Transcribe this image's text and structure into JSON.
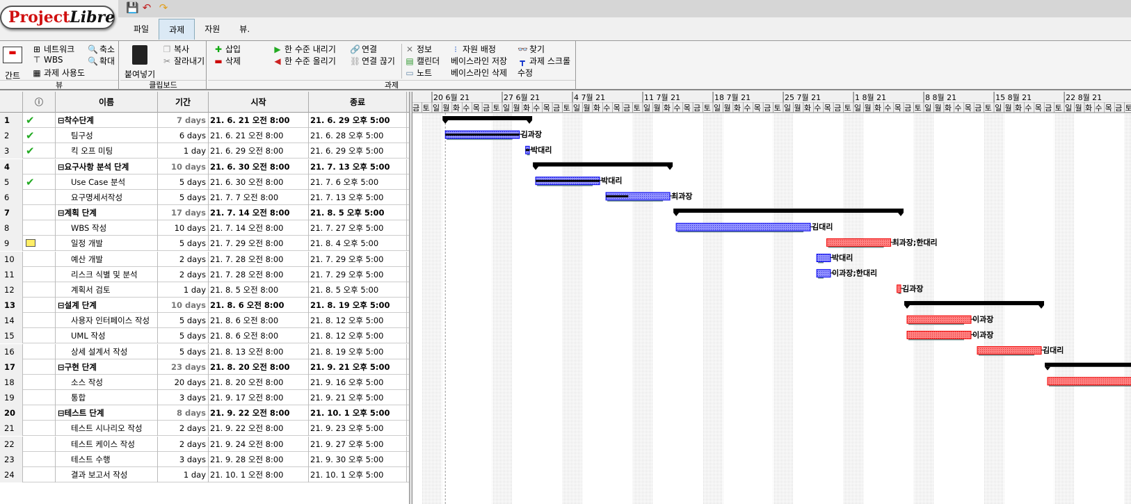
{
  "app": {
    "logo_text": "ProjectLibre",
    "logo_red": "Project",
    "logo_black": "Libre"
  },
  "quick_access": [
    {
      "icon": "save-icon"
    },
    {
      "icon": "undo-icon"
    },
    {
      "icon": "redo-icon"
    }
  ],
  "tabs": [
    {
      "label": "파일"
    },
    {
      "label": "과제",
      "active": true
    },
    {
      "label": "자원"
    },
    {
      "label": "뷰."
    }
  ],
  "ribbon": {
    "view": {
      "label": "뷰",
      "gantt": "간트",
      "network": "네트워크",
      "wbs": "WBS",
      "task_usage": "과제 사용도",
      "zoom_out": "축소",
      "zoom_in": "확대"
    },
    "clipboard": {
      "label": "클립보드",
      "paste": "붙여넣기",
      "copy": "복사",
      "cut": "잘라내기"
    },
    "task": {
      "label": "과제",
      "insert": "삽입",
      "delete": "삭제",
      "indent": "한 수준 내리기",
      "outdent": "한 수준 올리기",
      "link": "연결",
      "unlink": "연결 끊기",
      "info": "정보",
      "calendar": "캘린더",
      "notes": "노트",
      "assign": "자원 배정",
      "save_baseline": "베이스라인 저장",
      "clear_baseline": "베이스라인 삭제",
      "find": "찾기",
      "scroll_to_task": "과제 스크롤",
      "edit": "수정"
    }
  },
  "table": {
    "headers": {
      "info": "ⓘ",
      "name": "이름",
      "duration": "기간",
      "start": "시작",
      "finish": "종료"
    },
    "rows": [
      {
        "id": "1",
        "ind": "check",
        "name": "⊟착수단계",
        "dur": "7 days",
        "start": "21. 6. 21 오전 8:00",
        "end": "21. 6. 29 오후 5:00",
        "summary": true,
        "gs": "2021-06-21T08",
        "ge": "2021-06-29T17"
      },
      {
        "id": "2",
        "ind": "check",
        "name": "팀구성",
        "dur": "6 days",
        "start": "21. 6. 21 오전 8:00",
        "end": "21. 6. 28 오후 5:00",
        "gs": "2021-06-21T08",
        "ge": "2021-06-28T17",
        "res": "김과장",
        "progress": 100
      },
      {
        "id": "3",
        "ind": "check",
        "name": "킥 오프 미팅",
        "dur": "1 day",
        "start": "21. 6. 29 오전 8:00",
        "end": "21. 6. 29 오후 5:00",
        "gs": "2021-06-29T08",
        "ge": "2021-06-29T17",
        "res": "박대리",
        "progress": 100
      },
      {
        "id": "4",
        "name": "⊟요구사항 분석 단계",
        "dur": "10 days",
        "start": "21. 6. 30 오전 8:00",
        "end": "21. 7. 13 오후 5:00",
        "summary": true,
        "gs": "2021-06-30T08",
        "ge": "2021-07-13T17"
      },
      {
        "id": "5",
        "ind": "check",
        "name": "Use Case 분석",
        "dur": "5 days",
        "start": "21. 6. 30 오전 8:00",
        "end": "21. 7. 6 오후 5:00",
        "gs": "2021-06-30T08",
        "ge": "2021-07-06T17",
        "res": "박대리",
        "progress": 100
      },
      {
        "id": "6",
        "name": "요구명세서작성",
        "dur": "5 days",
        "start": "21. 7. 7 오전 8:00",
        "end": "21. 7. 13 오후 5:00",
        "gs": "2021-07-07T08",
        "ge": "2021-07-13T17",
        "res": "최과장",
        "progress": 35
      },
      {
        "id": "7",
        "name": "⊟계획 단계",
        "dur": "17 days",
        "start": "21. 7. 14 오전 8:00",
        "end": "21. 8. 5 오후 5:00",
        "summary": true,
        "gs": "2021-07-14T08",
        "ge": "2021-08-05T17"
      },
      {
        "id": "8",
        "name": "WBS 작성",
        "dur": "10 days",
        "start": "21. 7. 14 오전 8:00",
        "end": "21. 7. 27 오후 5:00",
        "gs": "2021-07-14T08",
        "ge": "2021-07-27T17",
        "res": "김대리"
      },
      {
        "id": "9",
        "ind": "calendar",
        "name": "일정 개발",
        "dur": "5 days",
        "start": "21. 7. 29 오전 8:00",
        "end": "21. 8. 4 오후 5:00",
        "gs": "2021-07-29T08",
        "ge": "2021-08-04T17",
        "res": "최과장;한대리",
        "critical": true
      },
      {
        "id": "10",
        "name": "예산 개발",
        "dur": "2 days",
        "start": "21. 7. 28 오전 8:00",
        "end": "21. 7. 29 오후 5:00",
        "gs": "2021-07-28T08",
        "ge": "2021-07-29T17",
        "res": "박대리"
      },
      {
        "id": "11",
        "name": "리스크 식별 및 분석",
        "dur": "2 days",
        "start": "21. 7. 28 오전 8:00",
        "end": "21. 7. 29 오후 5:00",
        "gs": "2021-07-28T08",
        "ge": "2021-07-29T17",
        "res": "이과장;한대리"
      },
      {
        "id": "12",
        "name": "계획서 검토",
        "dur": "1 day",
        "start": "21. 8. 5 오전 8:00",
        "end": "21. 8. 5 오후 5:00",
        "gs": "2021-08-05T08",
        "ge": "2021-08-05T17",
        "res": "김과장",
        "critical": true
      },
      {
        "id": "13",
        "name": "⊟설계 단계",
        "dur": "10 days",
        "start": "21. 8. 6 오전 8:00",
        "end": "21. 8. 19 오후 5:00",
        "summary": true,
        "gs": "2021-08-06T08",
        "ge": "2021-08-19T17"
      },
      {
        "id": "14",
        "name": "사용자 인터페이스 작성",
        "dur": "5 days",
        "start": "21. 8. 6 오전 8:00",
        "end": "21. 8. 12 오후 5:00",
        "gs": "2021-08-06T08",
        "ge": "2021-08-12T17",
        "res": "이과장",
        "critical": true
      },
      {
        "id": "15",
        "name": "UML 작성",
        "dur": "5 days",
        "start": "21. 8. 6 오전 8:00",
        "end": "21. 8. 12 오후 5:00",
        "gs": "2021-08-06T08",
        "ge": "2021-08-12T17",
        "res": "이과장",
        "critical": true
      },
      {
        "id": "16",
        "name": "상세 설계서 작성",
        "dur": "5 days",
        "start": "21. 8. 13 오전 8:00",
        "end": "21. 8. 19 오후 5:00",
        "gs": "2021-08-13T08",
        "ge": "2021-08-19T17",
        "res": "김대리",
        "critical": true
      },
      {
        "id": "17",
        "name": "⊟구현 단계",
        "dur": "23 days",
        "start": "21. 8. 20 오전 8:00",
        "end": "21. 9. 21 오후 5:00",
        "summary": true,
        "gs": "2021-08-20T08",
        "ge": "2021-09-21T17"
      },
      {
        "id": "18",
        "name": "소스 작성",
        "dur": "20 days",
        "start": "21. 8. 20 오전 8:00",
        "end": "21. 9. 16 오후 5:00",
        "gs": "2021-08-20T08",
        "ge": "2021-09-16T17",
        "critical": true
      },
      {
        "id": "19",
        "name": "통합",
        "dur": "3 days",
        "start": "21. 9. 17 오전 8:00",
        "end": "21. 9. 21 오후 5:00"
      },
      {
        "id": "20",
        "name": "⊟테스트 단계",
        "dur": "8 days",
        "start": "21. 9. 22 오전 8:00",
        "end": "21. 10. 1 오후 5:00",
        "summary": true
      },
      {
        "id": "21",
        "name": "테스트 시나리오 작성",
        "dur": "2 days",
        "start": "21. 9. 22 오전 8:00",
        "end": "21. 9. 23 오후 5:00"
      },
      {
        "id": "22",
        "name": "테스트 케이스 작성",
        "dur": "2 days",
        "start": "21. 9. 24 오전 8:00",
        "end": "21. 9. 27 오후 5:00"
      },
      {
        "id": "23",
        "name": "테스트 수행",
        "dur": "3 days",
        "start": "21. 9. 28 오전 8:00",
        "end": "21. 9. 30 오후 5:00"
      },
      {
        "id": "24",
        "name": "결과 보고서 작성",
        "dur": "1 day",
        "start": "21. 10. 1 오전 8:00",
        "end": "21. 10. 1 오후 5:00"
      }
    ]
  },
  "timeline": {
    "weeks": [
      "20 6월 21",
      "27 6월 21",
      "4 7월 21",
      "11 7월 21",
      "18 7월 21",
      "25 7월 21",
      "1 8월 21",
      "8 8월 21",
      "15 8월 21",
      "22 8월 21"
    ],
    "days": [
      "일",
      "월",
      "화",
      "수",
      "목",
      "금",
      "토"
    ],
    "first_week_start": "2021-06-20"
  },
  "colors": {
    "normal_bar": "#5050ff",
    "critical_bar": "#ff5050",
    "summary": "#000000",
    "baseline": "#6a8a8a"
  }
}
